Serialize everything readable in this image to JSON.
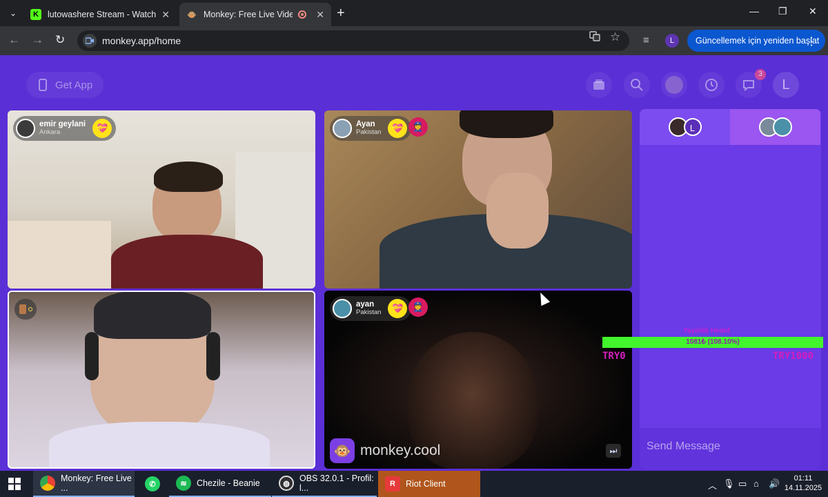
{
  "browser": {
    "tabs": [
      {
        "title": "lutowashere Stream - Watch Liv",
        "icon": "kick-icon"
      },
      {
        "title": "Monkey: Free Live Video Ch",
        "icon": "monkey-icon",
        "active": true
      }
    ],
    "url": "monkey.app/home",
    "update_label": "Güncellemek için yeniden başlat",
    "profile_initial": "L"
  },
  "app": {
    "get_app_label": "Get App",
    "notification_count": "3",
    "profile_initial": "L",
    "tiles": [
      {
        "name": "emir geylani",
        "location": "Ankara"
      },
      {
        "name": "Ayan",
        "location": "Pakistan"
      },
      {
        "name": "",
        "location": ""
      },
      {
        "name": "ayan",
        "location": "Pakistan",
        "watermark": "monkey.cool"
      }
    ],
    "chat": {
      "tab_a_initial": "L",
      "placeholder": "Send Message"
    },
    "goal": {
      "title": "Yayinlik Hedef",
      "progress_text": "1081₺ (108.10%)",
      "progress_percent": 108.1,
      "min_label": "TRY0",
      "max_label": "TRY1000"
    }
  },
  "taskbar": {
    "items": [
      {
        "label": "Monkey: Free Live ...",
        "icon": "chrome-icon"
      },
      {
        "label": "",
        "icon": "whatsapp-icon"
      },
      {
        "label": "Chezile - Beanie",
        "icon": "spotify-icon"
      },
      {
        "label": "OBS 32.0.1 - Profil: l...",
        "icon": "obs-icon"
      },
      {
        "label": "Riot Client",
        "icon": "riot-icon"
      }
    ],
    "time": "01:11",
    "date": "14.11.2025"
  },
  "colors": {
    "app_bg": "#5b2fd6",
    "gift_yellow": "#ffe31a",
    "goal_green": "#42f52c",
    "update_blue": "#0b57d0"
  }
}
